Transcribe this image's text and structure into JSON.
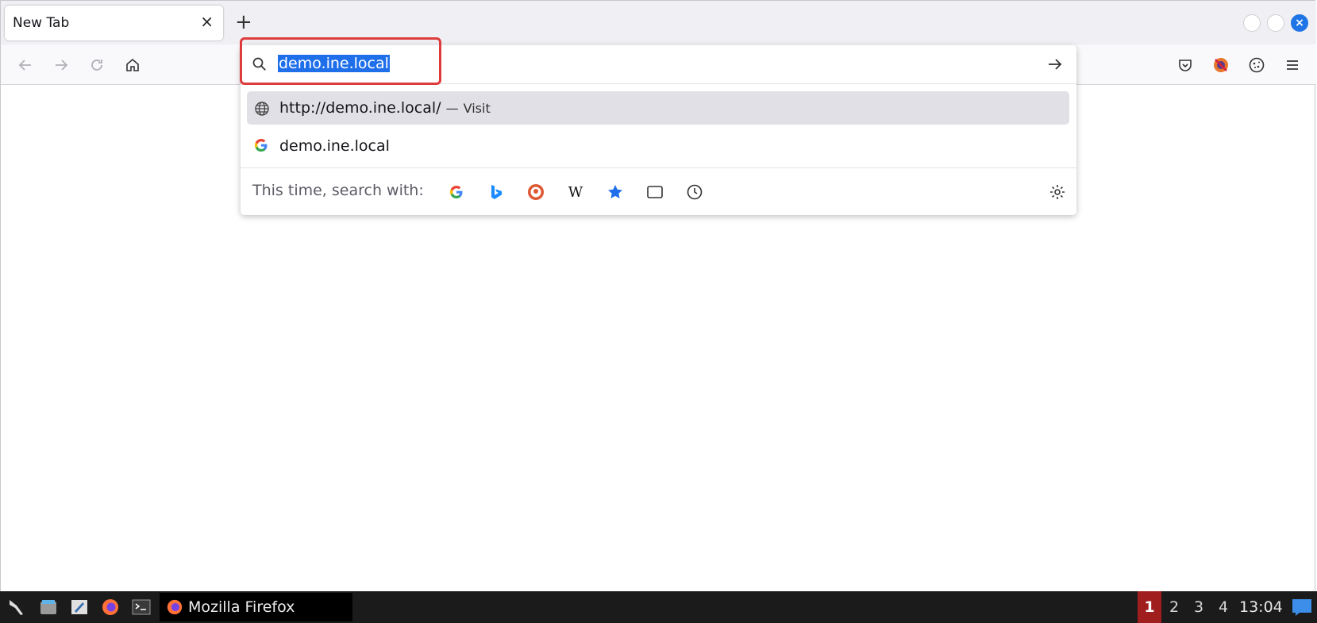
{
  "browser": {
    "tab": {
      "title": "New Tab",
      "close": "×"
    },
    "new_tab": "+",
    "window_close": "×"
  },
  "urlbar": {
    "value": "demo.ine.local",
    "suggestions": [
      {
        "url": "http://demo.ine.local/",
        "separator": "—",
        "action": "Visit",
        "icon": "globe-icon"
      },
      {
        "text": "demo.ine.local",
        "icon": "google-icon"
      }
    ],
    "one_off_label": "This time, search with:",
    "engines": [
      "google-icon",
      "bing-icon",
      "duckduckgo-icon",
      "wikipedia-icon",
      "bookmarks-star-icon",
      "tabs-icon",
      "history-icon"
    ],
    "wiki_glyph": "W"
  },
  "taskbar": {
    "task_label": "Mozilla Firefox",
    "workspaces": [
      "1",
      "2",
      "3",
      "4"
    ],
    "active_workspace": "1",
    "clock": "13:04"
  },
  "colors": {
    "accent": "#1f75e6",
    "highlight_box": "#de3c3c",
    "workspace_active": "#a01e1e"
  }
}
